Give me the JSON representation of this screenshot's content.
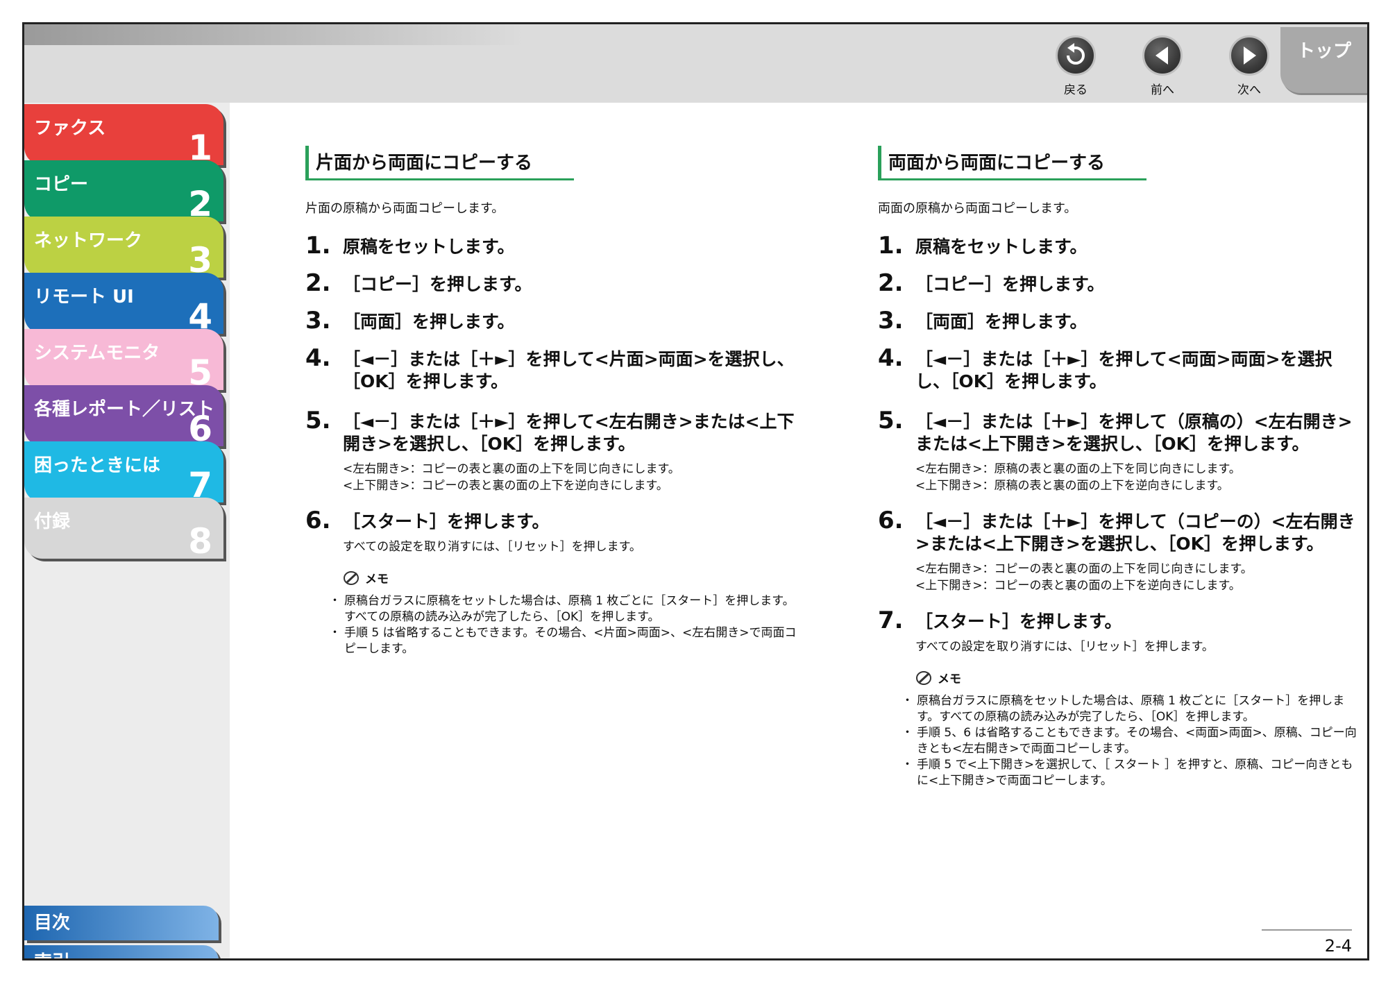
{
  "nav": {
    "back_label": "戻る",
    "prev_label": "前へ",
    "next_label": "次へ",
    "top_label": "トップ"
  },
  "sidebar": {
    "chapters": [
      {
        "label": "ファクス",
        "num": "1",
        "color": "#e8403c"
      },
      {
        "label": "コピー",
        "num": "2",
        "color": "#0f9a68"
      },
      {
        "label": "ネットワーク",
        "num": "3",
        "color": "#bcd143"
      },
      {
        "label": "リモート UI",
        "num": "4",
        "color": "#1d6fba"
      },
      {
        "label": "システムモニタ",
        "num": "5",
        "color": "#f7b9d6"
      },
      {
        "label": "各種レポート／リスト",
        "num": "6",
        "color": "#7d4fa8"
      },
      {
        "label": "困ったときには",
        "num": "7",
        "color": "#1fb9e4"
      },
      {
        "label": "付録",
        "num": "8",
        "color": "#d7d7d7"
      }
    ],
    "toc_label": "目次",
    "index_label": "索引"
  },
  "left": {
    "title": "片面から両面にコピーする",
    "intro": "片面の原稿から両面コピーします。",
    "steps": [
      {
        "num": "1.",
        "text": "原稿をセットします。"
      },
      {
        "num": "2.",
        "text": "［コピー］を押します。"
      },
      {
        "num": "3.",
        "text": "［両面］を押します。"
      },
      {
        "num": "4.",
        "text": "［◄－］または［＋►］を押して<片面>両面>を選択し、［OK］を押します。"
      },
      {
        "num": "5.",
        "text": "［◄－］または［＋►］を押して<左右開き>または<上下開き>を選択し、［OK］を押します。",
        "note1": "<左右開き>：コピーの表と裏の面の上下を同じ向きにします。",
        "note2": "<上下開き>：コピーの表と裏の面の上下を逆向きにします。"
      },
      {
        "num": "6.",
        "text": "［スタート］を押します。",
        "note1": "すべての設定を取り消すには、［リセット］を押します。"
      }
    ],
    "memo_label": "メモ",
    "memo": [
      "原稿台ガラスに原稿をセットした場合は、原稿 1 枚ごとに［スタート］を押します。すべての原稿の読み込みが完了したら、［OK］を押します。",
      "手順 5 は省略することもできます。その場合、<片面>両面>、<左右開き>で両面コピーします。"
    ]
  },
  "right": {
    "title": "両面から両面にコピーする",
    "intro": "両面の原稿から両面コピーします。",
    "steps": [
      {
        "num": "1.",
        "text": "原稿をセットします。"
      },
      {
        "num": "2.",
        "text": "［コピー］を押します。"
      },
      {
        "num": "3.",
        "text": "［両面］を押します。"
      },
      {
        "num": "4.",
        "text": "［◄－］または［＋►］を押して<両面>両面>を選択し、［OK］を押します。"
      },
      {
        "num": "5.",
        "text": "［◄－］または［＋►］を押して（原稿の）<左右開き>または<上下開き>を選択し、［OK］を押します。",
        "note1": "<左右開き>：原稿の表と裏の面の上下を同じ向きにします。",
        "note2": "<上下開き>：原稿の表と裏の面の上下を逆向きにします。"
      },
      {
        "num": "6.",
        "text": "［◄－］または［＋►］を押して（コピーの）<左右開き>または<上下開き>を選択し、［OK］を押します。",
        "note1": "<左右開き>：コピーの表と裏の面の上下を同じ向きにします。",
        "note2": "<上下開き>：コピーの表と裏の面の上下を逆向きにします。"
      },
      {
        "num": "7.",
        "text": "［スタート］を押します。",
        "note1": "すべての設定を取り消すには、［リセット］を押します。"
      }
    ],
    "memo_label": "メモ",
    "memo": [
      "原稿台ガラスに原稿をセットした場合は、原稿 1 枚ごとに［スタート］を押します。すべての原稿の読み込みが完了したら、［OK］を押します。",
      "手順 5、6 は省略することもできます。その場合、<両面>両面>、原稿、コピー向きとも<左右開き>で両面コピーします。",
      "手順 5 で<上下開き>を選択して、［ スタート ］を押すと、原稿、コピー向きともに<上下開き>で両面コピーします。"
    ]
  },
  "page_number": "2-4"
}
